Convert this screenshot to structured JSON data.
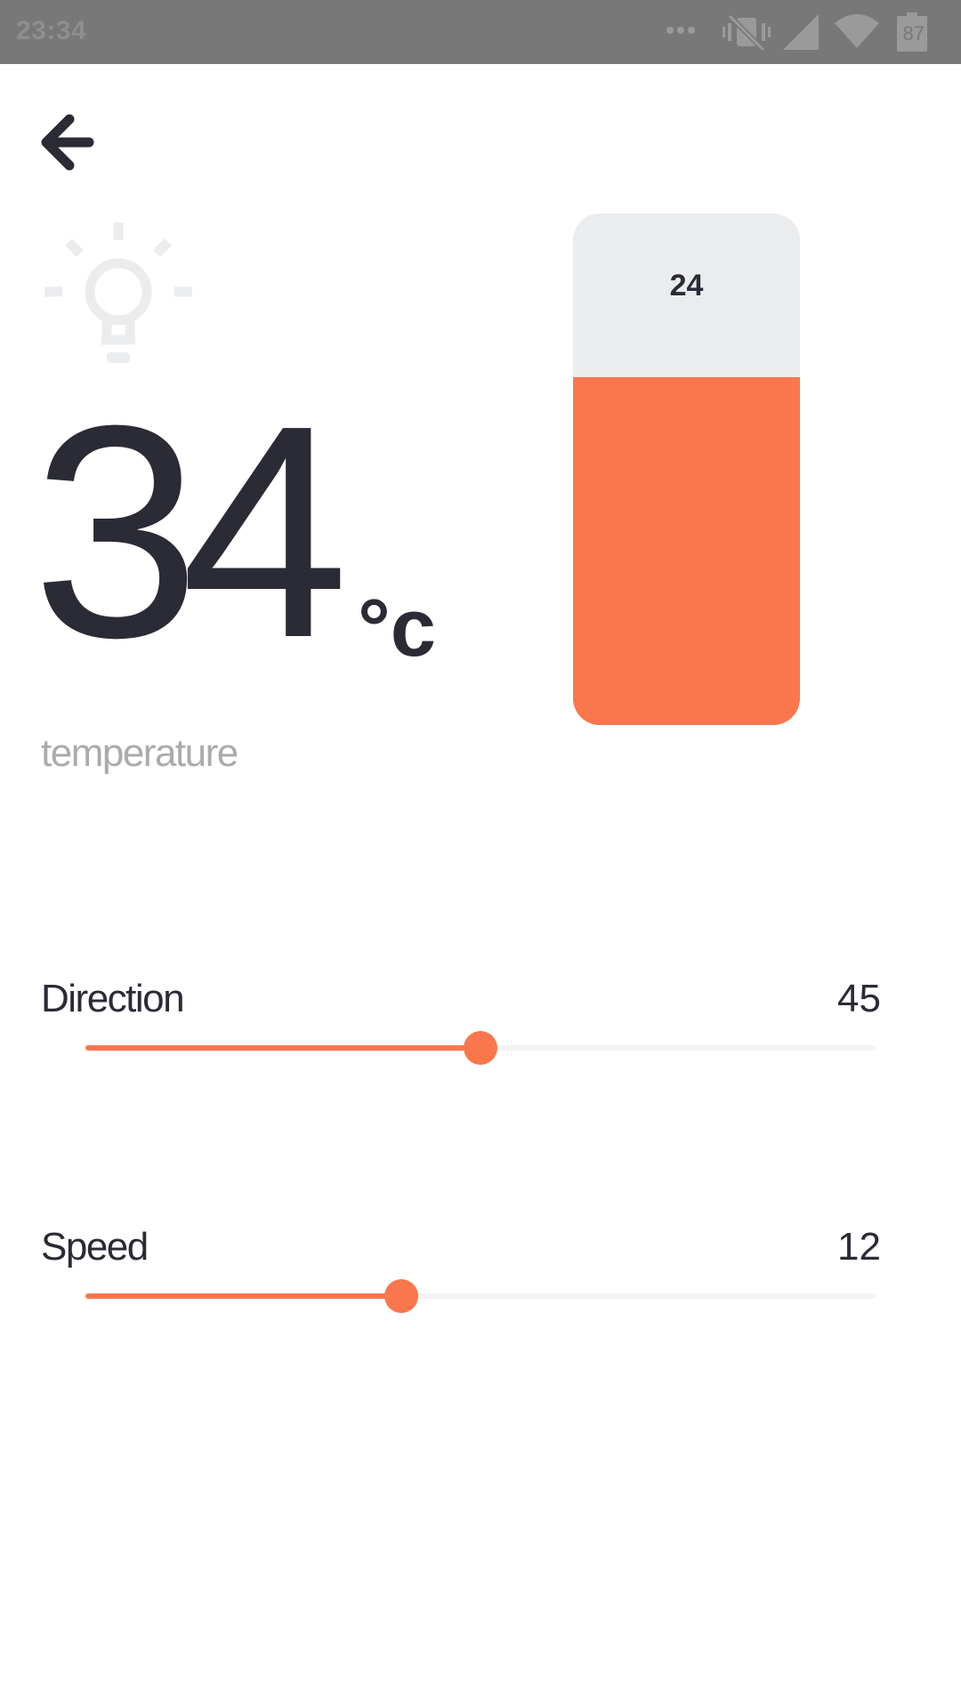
{
  "status_bar": {
    "time": "23:34",
    "battery_level": "87",
    "icons": [
      "more-dots-icon",
      "vibrate-off-icon",
      "signal-icon",
      "wifi-icon",
      "battery-icon"
    ]
  },
  "header": {
    "back_icon": "arrow-left-icon"
  },
  "device": {
    "icon": "lightbulb-icon"
  },
  "temperature": {
    "value": "34",
    "unit": "°c",
    "label": "temperature"
  },
  "level": {
    "value": "24",
    "fill_fraction": 0.68
  },
  "sliders": [
    {
      "label": "Direction",
      "value": "45",
      "fraction": 0.5
    },
    {
      "label": "Speed",
      "value": "12",
      "fraction": 0.4
    }
  ],
  "colors": {
    "accent": "#fa764c",
    "text": "#2b2b35",
    "muted": "#ababab",
    "track": "#f3f3f3",
    "bar_bg": "#ebecee"
  }
}
